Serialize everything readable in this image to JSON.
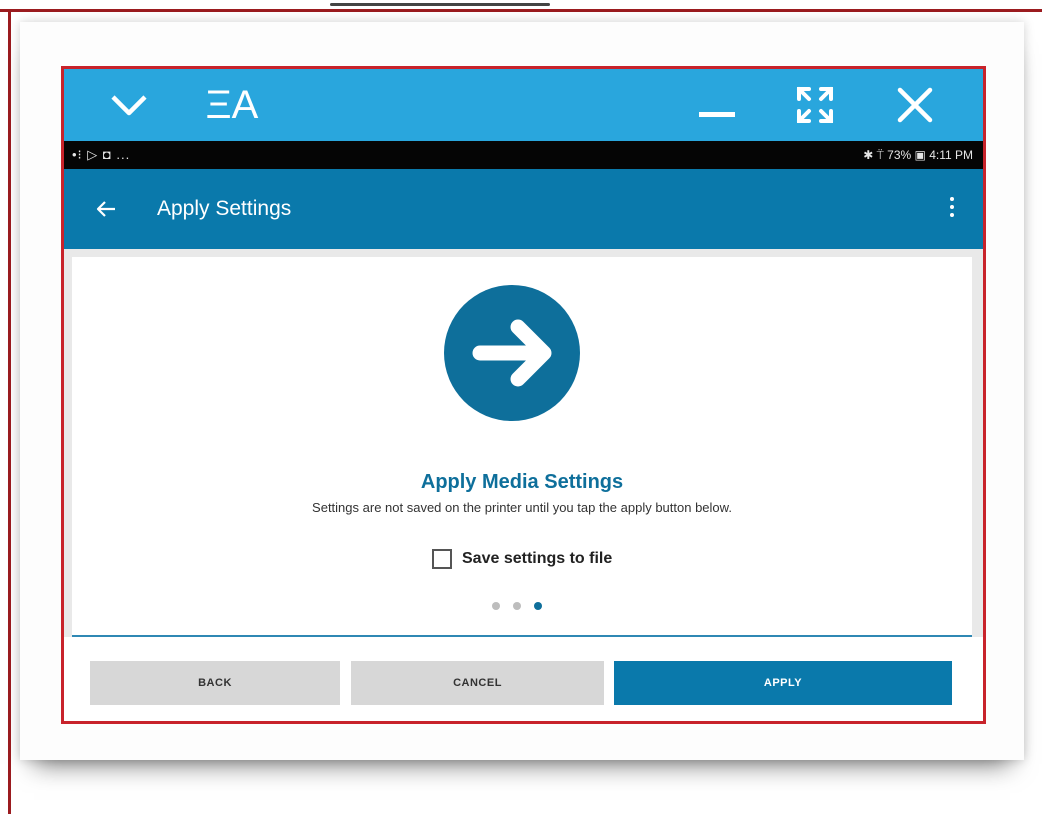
{
  "window": {
    "logo_text": "ΞA",
    "status_left": "•⁝ ▷ ◘ ...",
    "status_right": "✱ ⍡ 73% ▣ 4:11 PM"
  },
  "appbar": {
    "title": "Apply Settings"
  },
  "content": {
    "heading": "Apply Media Settings",
    "description": "Settings are not saved on the printer until you tap the apply button below.",
    "save_checkbox_label": "Save settings to file",
    "save_checkbox_checked": false,
    "pager": {
      "total": 3,
      "active": 3
    }
  },
  "footer": {
    "back_label": "BACK",
    "cancel_label": "CANCEL",
    "apply_label": "APPLY"
  },
  "colors": {
    "titlebar": "#29a6dd",
    "appbar": "#0a79ab",
    "accent": "#0e6f9b",
    "frame": "#c8232b"
  }
}
